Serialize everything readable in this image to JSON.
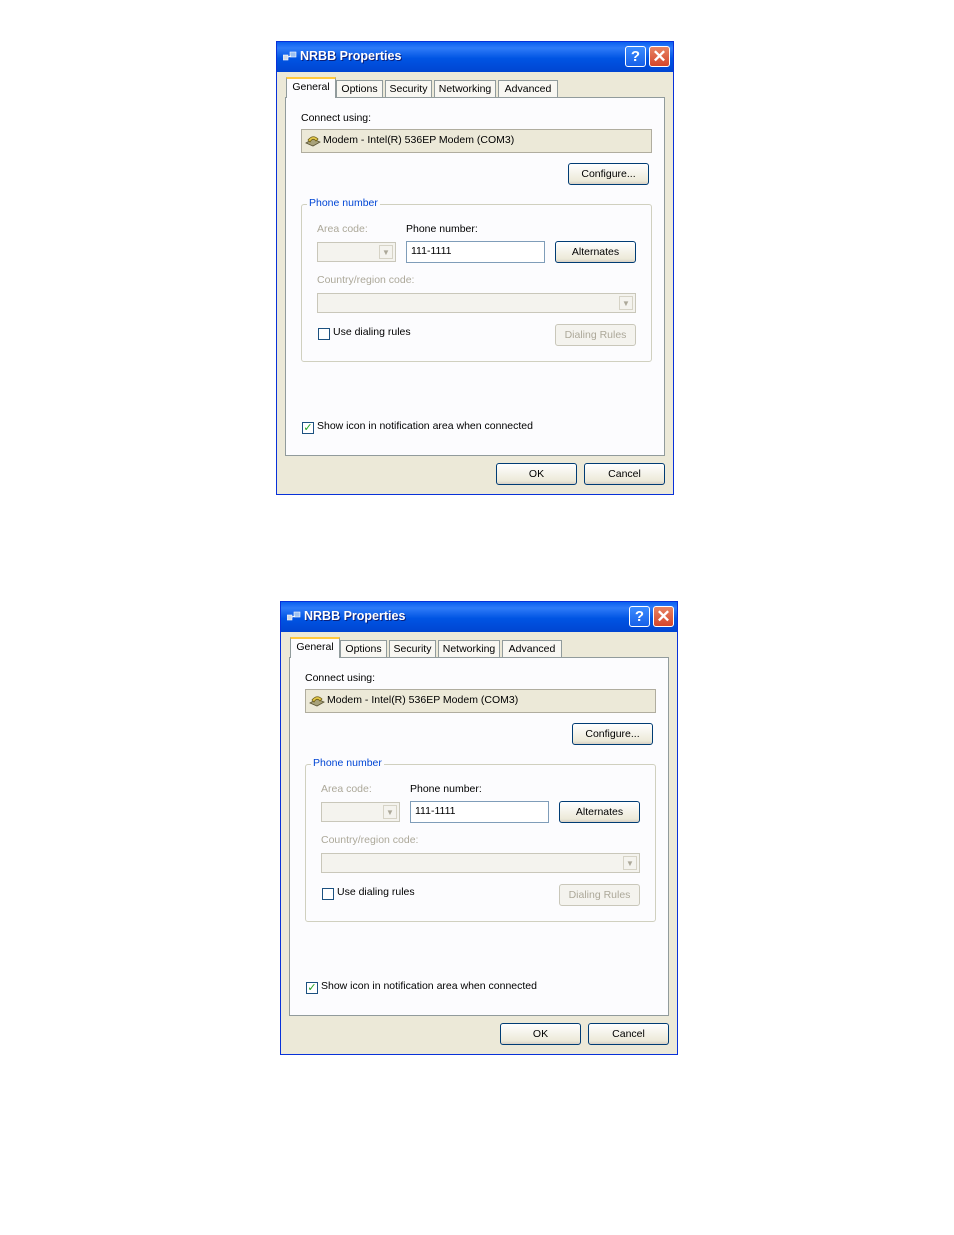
{
  "dialogs": [
    {
      "title": "NRBB Properties",
      "help_button": "?",
      "close_button": "✕",
      "tabs": [
        "General",
        "Options",
        "Security",
        "Networking",
        "Advanced"
      ],
      "connect_using_label": "Connect using:",
      "device": "Modem - Intel(R) 536EP Modem (COM3)",
      "configure_button": "Configure...",
      "phone_group_title": "Phone number",
      "area_code_label": "Area code:",
      "phone_number_label": "Phone number:",
      "phone_number_value": "111-1111",
      "alternates_button": "Alternates",
      "country_label": "Country/region code:",
      "use_dialing_rules_label": "Use dialing rules",
      "use_dialing_rules_checked": false,
      "dialing_rules_button": "Dialing Rules",
      "show_icon_label": "Show icon in notification area when connected",
      "show_icon_checked": true,
      "ok_button": "OK",
      "cancel_button": "Cancel"
    },
    {
      "title": "NRBB Properties",
      "help_button": "?",
      "close_button": "✕",
      "tabs": [
        "General",
        "Options",
        "Security",
        "Networking",
        "Advanced"
      ],
      "connect_using_label": "Connect using:",
      "device": "Modem - Intel(R) 536EP Modem (COM3)",
      "configure_button": "Configure...",
      "phone_group_title": "Phone number",
      "area_code_label": "Area code:",
      "phone_number_label": "Phone number:",
      "phone_number_value": "111-1111",
      "alternates_button": "Alternates",
      "country_label": "Country/region code:",
      "use_dialing_rules_label": "Use dialing rules",
      "use_dialing_rules_checked": false,
      "dialing_rules_button": "Dialing Rules",
      "show_icon_label": "Show icon in notification area when connected",
      "show_icon_checked": true,
      "ok_button": "OK",
      "cancel_button": "Cancel"
    }
  ],
  "icons": {
    "app": "network-connection-icon",
    "device": "modem-icon",
    "checkmark": "✓",
    "dropdown": "▼"
  },
  "colors": {
    "titlebar": "#0054e3",
    "dialog_bg": "#ece9d8",
    "group_title": "#0046d5",
    "active_tab_accent": "#ffc83c",
    "close_button": "#d5452a"
  }
}
